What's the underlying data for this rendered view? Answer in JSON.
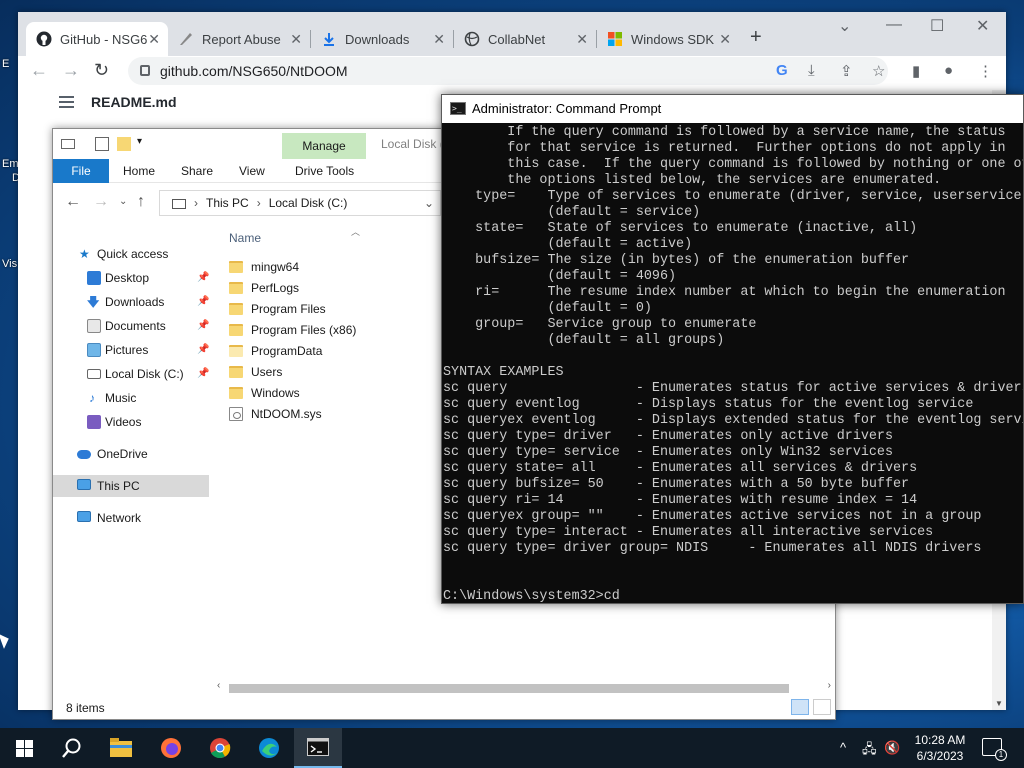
{
  "desktop": {
    "labels": [
      "E",
      "Em",
      "D",
      "Vis"
    ]
  },
  "browser": {
    "tabs": [
      {
        "label": "GitHub - NSG6",
        "icon": "github-icon"
      },
      {
        "label": "Report Abuse",
        "icon": "report-icon"
      },
      {
        "label": "Downloads",
        "icon": "download-icon"
      },
      {
        "label": "CollabNet",
        "icon": "collabnet-icon"
      },
      {
        "label": "Windows SDK",
        "icon": "windows-icon"
      }
    ],
    "url": "github.com/NSG650/NtDOOM",
    "readme_title": "README.md"
  },
  "explorer": {
    "manage_label": "Manage",
    "drive_tools_label": "Drive Tools",
    "location_tab": "Local Disk (",
    "ribbon_tabs": [
      "File",
      "Home",
      "Share",
      "View"
    ],
    "breadcrumb": [
      "This PC",
      "Local Disk (C:)"
    ],
    "column_name": "Name",
    "nav": {
      "quick_access": "Quick access",
      "desktop": "Desktop",
      "downloads": "Downloads",
      "documents": "Documents",
      "pictures": "Pictures",
      "local_disk": "Local Disk (C:)",
      "music": "Music",
      "videos": "Videos",
      "onedrive": "OneDrive",
      "this_pc": "This PC",
      "network": "Network"
    },
    "files": [
      "mingw64",
      "PerfLogs",
      "Program Files",
      "Program Files (x86)",
      "ProgramData",
      "Users",
      "Windows",
      "NtDOOM.sys"
    ],
    "status": "8 items"
  },
  "cmd": {
    "title": "Administrator: Command Prompt",
    "lines": [
      "        If the query command is followed by a service name, the status",
      "        for that service is returned.  Further options do not apply in",
      "        this case.  If the query command is followed by nothing or one of",
      "        the options listed below, the services are enumerated.",
      "    type=    Type of services to enumerate (driver, service, userservice, all)",
      "             (default = service)",
      "    state=   State of services to enumerate (inactive, all)",
      "             (default = active)",
      "    bufsize= The size (in bytes) of the enumeration buffer",
      "             (default = 4096)",
      "    ri=      The resume index number at which to begin the enumeration",
      "             (default = 0)",
      "    group=   Service group to enumerate",
      "             (default = all groups)",
      "",
      "SYNTAX EXAMPLES",
      "sc query                - Enumerates status for active services & drivers",
      "sc query eventlog       - Displays status for the eventlog service",
      "sc queryex eventlog     - Displays extended status for the eventlog service",
      "sc query type= driver   - Enumerates only active drivers",
      "sc query type= service  - Enumerates only Win32 services",
      "sc query state= all     - Enumerates all services & drivers",
      "sc query bufsize= 50    - Enumerates with a 50 byte buffer",
      "sc query ri= 14         - Enumerates with resume index = 14",
      "sc queryex group= \"\"    - Enumerates active services not in a group",
      "sc query type= interact - Enumerates all interactive services",
      "sc query type= driver group= NDIS     - Enumerates all NDIS drivers",
      "",
      "",
      "C:\\Windows\\system32>cd"
    ]
  },
  "taskbar": {
    "time": "10:28 AM",
    "date": "6/3/2023",
    "notification_count": "1"
  },
  "colors": {
    "manage_tab": "#c8e8c0",
    "file_tab": "#1979ca",
    "taskbar": "#0f1b26"
  }
}
